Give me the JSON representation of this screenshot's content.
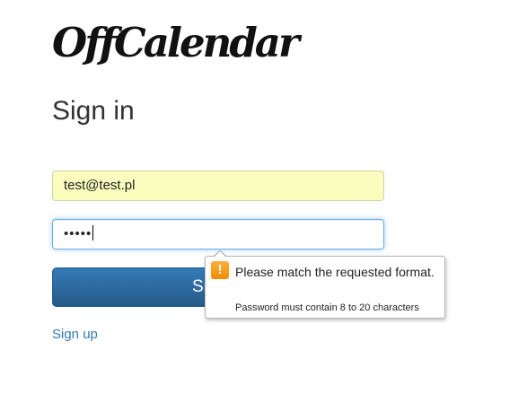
{
  "app": {
    "logo_text": "OffCalendar"
  },
  "signin": {
    "heading": "Sign in",
    "email_value": "test@test.pl",
    "password_masked": "•••••",
    "submit_label": "Sign in",
    "submit_visible_text": "Si",
    "signup_link": "Sign up"
  },
  "validation_tooltip": {
    "title": "Please match the requested format.",
    "detail": "Password must contain 8 to 20 characters",
    "icon": "warning-icon",
    "icon_glyph": "!"
  },
  "colors": {
    "primary": "#337ab7",
    "autofill": "#fbfdbe",
    "focus": "#66afe9",
    "warning": "#f5a623"
  }
}
